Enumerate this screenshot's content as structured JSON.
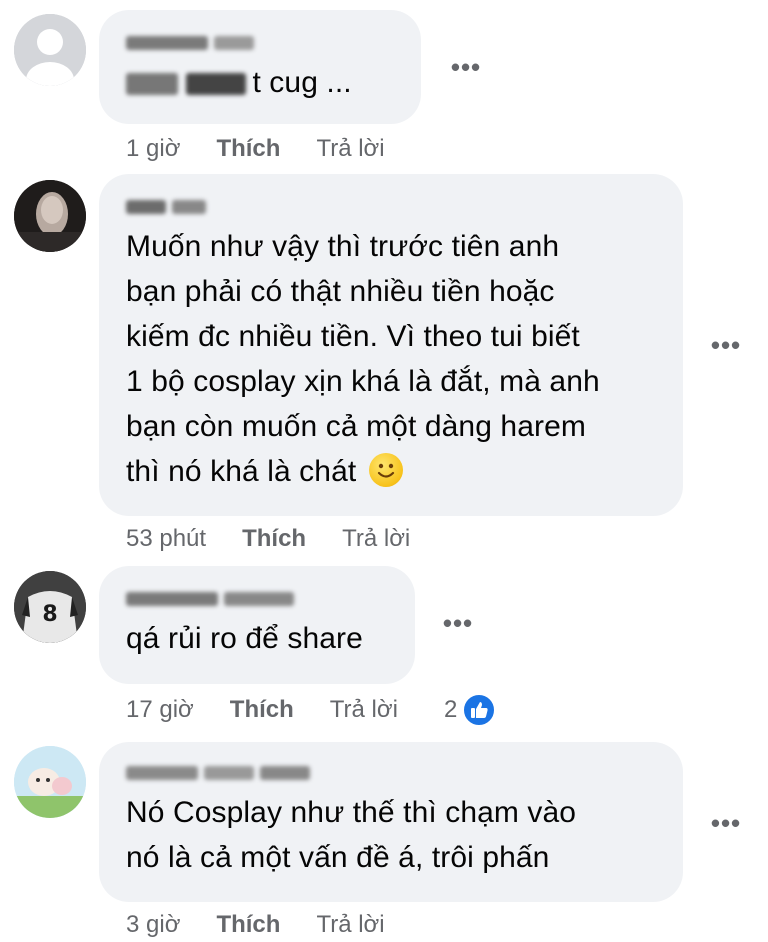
{
  "comments": [
    {
      "text_lines": [
        "t cug ..."
      ],
      "time": "1 giờ",
      "like_label": "Thích",
      "reply_label": "Trả lời",
      "more_label": "•••"
    },
    {
      "text_lines": [
        "Muốn như vậy thì trước tiên anh",
        "bạn phải có thật nhiều tiền hoặc",
        "kiếm đc nhiều tiền. Vì theo tui biết",
        "1 bộ cosplay xịn khá là đắt, mà anh",
        "bạn còn muốn cả một dàng harem",
        "thì nó khá là chát"
      ],
      "emoji": "slightly-smiling-face",
      "time": "53 phút",
      "like_label": "Thích",
      "reply_label": "Trả lời",
      "more_label": "•••"
    },
    {
      "text_lines": [
        "qá rủi ro để share"
      ],
      "time": "17 giờ",
      "like_label": "Thích",
      "reply_label": "Trả lời",
      "reaction_count": "2",
      "reaction_icon": "thumbs-up-icon",
      "more_label": "•••"
    },
    {
      "text_lines": [
        "Nó Cosplay như thế thì chạm vào",
        "nó là cả một vấn đề á, trôi phấn"
      ],
      "time": "3 giờ",
      "like_label": "Thích",
      "reply_label": "Trả lời",
      "more_label": "•••"
    }
  ],
  "colors": {
    "bubble": "#f0f2f5",
    "meta_text": "#65676b",
    "like_badge": "#1b74e4"
  }
}
